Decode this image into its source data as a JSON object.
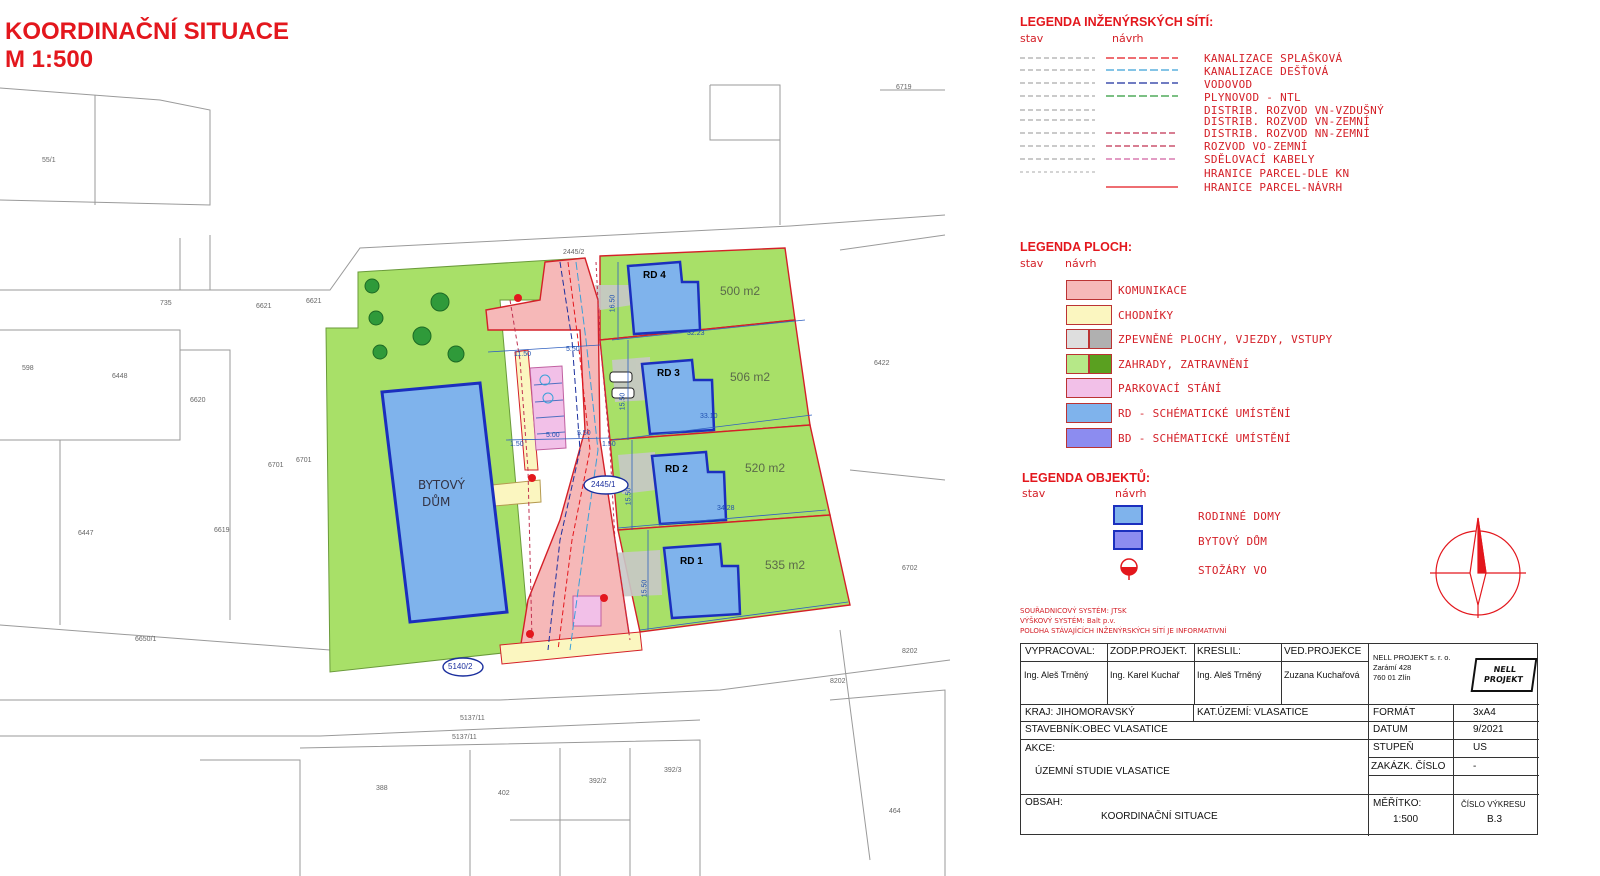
{
  "title": {
    "line1": "KOORDINAČNÍ  SITUACE",
    "line2": "M 1:500"
  },
  "legend_networks": {
    "heading": "LEGENDA INŽENÝRSKÝCH SÍTÍ:",
    "col_stav": "stav",
    "col_navrh": "návrh",
    "items": [
      {
        "label": "KANALIZACE SPLAŠKOVÁ",
        "color": "#e3171d"
      },
      {
        "label": "KANALIZACE DEŠŤOVÁ",
        "color": "#3aa0d8"
      },
      {
        "label": "VODOVOD",
        "color": "#1b2f9e"
      },
      {
        "label": "PLYNOVOD - NTL",
        "color": "#2f9a3a"
      },
      {
        "label": "DISTRIB. ROZVOD VN-VZDUŠNÝ",
        "color": "#888888"
      },
      {
        "label": "DISTRIB. ROZVOD VN-ZEMNÍ",
        "color": "#888888"
      },
      {
        "label": "DISTRIB. ROZVOD NN-ZEMNÍ",
        "color": "#c03050"
      },
      {
        "label": "ROZVOD VO-ZEMNÍ",
        "color": "#c03050"
      },
      {
        "label": "SDĚLOVACÍ KABELY",
        "color": "#d060a0"
      },
      {
        "label": "HRANICE PARCEL-DLE KN",
        "color": "#aaaaaa"
      },
      {
        "label": "HRANICE PARCEL-NÁVRH",
        "color": "#e3171d"
      }
    ]
  },
  "legend_areas": {
    "heading": "LEGENDA PLOCH:",
    "col_stav": "stav",
    "col_navrh": "návrh",
    "items": [
      {
        "label": "KOMUNIKACE",
        "color": "#f6b8b8"
      },
      {
        "label": "CHODNÍKY",
        "color": "#fbf6c0"
      },
      {
        "label": "ZPEVNĚNÉ PLOCHY, VJEZDY, VSTUPY",
        "color": "#c8c8c8"
      },
      {
        "label": "ZAHRADY, ZATRAVNĚNÍ",
        "color": "#a8e068"
      },
      {
        "label": "PARKOVACÍ STÁNÍ",
        "color": "#f2c0e8"
      },
      {
        "label": "RD - SCHÉMATICKÉ UMÍSTĚNÍ",
        "color": "#7fb3ec"
      },
      {
        "label": "BD - SCHÉMATICKÉ UMÍSTĚNÍ",
        "color": "#8c8cf0"
      }
    ]
  },
  "legend_objects": {
    "heading": "LEGENDA OBJEKTŮ:",
    "col_stav": "stav",
    "col_navrh": "návrh",
    "items": [
      {
        "label": "RODINNÉ DOMY",
        "color": "#7fb3ec"
      },
      {
        "label": "BYTOVÝ DŮM",
        "color": "#8c8cf0"
      },
      {
        "label": "STOŽÁRY VO",
        "color": "#e3171d"
      }
    ]
  },
  "notes": [
    "SOUŘADNICOVÝ SYSTÉM: JTSK",
    "VÝŠKOVÝ SYSTÉM: Balt p.v.",
    "POLOHA STÁVAJÍCÍCH INŽENÝRSKÝCH SÍTÍ JE INFORMATIVNÍ"
  ],
  "title_block": {
    "vypracoval_label": "VYPRACOVAL:",
    "vypracoval": "Ing. Aleš Trněný",
    "zodp_label": "ZODP.PROJEKT.",
    "zodp": "Ing. Karel Kuchař",
    "kreslil_label": "KRESLIL:",
    "kreslil": "Ing. Aleš Trněný",
    "ved_label": "VED.PROJEKCE",
    "ved": "Zuzana Kuchařová",
    "company_name": "NELL PROJEKT s. r. o.",
    "company_street": "Zarámí 428",
    "company_city": "760 01 Zlín",
    "logo_text": "NELL PROJEKT",
    "kraj": "KRAJ: JIHOMORAVSKÝ",
    "kat": "KAT.ÚZEMÍ: VLASATICE",
    "stavebnik": "STAVEBNÍK:OBEC VLASATICE",
    "format_label": "FORMÁT",
    "format": "3xA4",
    "datum_label": "DATUM",
    "datum": "9/2021",
    "stupen_label": "STUPEŇ",
    "stupen": "US",
    "zakazka_label": "ZAKÁZK. ČÍSLO",
    "zakazka": "-",
    "akce_label": "AKCE:",
    "akce": "ÚZEMNÍ STUDIE VLASATICE",
    "obsah_label": "OBSAH:",
    "obsah": "KOORDINAČNÍ SITUACE",
    "meritko_label": "MĚŘÍTKO:",
    "meritko": "1:500",
    "cislo_label": "ČÍSLO VÝKRESU",
    "cislo": "B.3"
  },
  "map": {
    "houses": [
      {
        "label": "RD 4",
        "area": "500 m2"
      },
      {
        "label": "RD 3",
        "area": "506 m2"
      },
      {
        "label": "RD 2",
        "area": "520 m2"
      },
      {
        "label": "RD 1",
        "area": "535 m2"
      }
    ],
    "apartment_line1": "BYTOVÝ",
    "apartment_line2": "DŮM",
    "parcel_labels": [
      "55/1",
      "735",
      "6621",
      "6621",
      "598",
      "6448",
      "6620",
      "6701",
      "6701",
      "6447",
      "6619",
      "6650/1",
      "6422",
      "2445/2",
      "5137/11",
      "5137/11",
      "388",
      "402",
      "392/2",
      "392/3",
      "464",
      "8202",
      "8202",
      "6702",
      "6719"
    ],
    "road_labels": [
      "2445/1",
      "5140/2"
    ],
    "dimensions": [
      "16.50",
      "32.23",
      "11.50",
      "5.50",
      "15.50",
      "33.10",
      "1.50",
      "5.00",
      "5.50",
      "1.50",
      "15.50",
      "34.28",
      "15.50"
    ]
  }
}
